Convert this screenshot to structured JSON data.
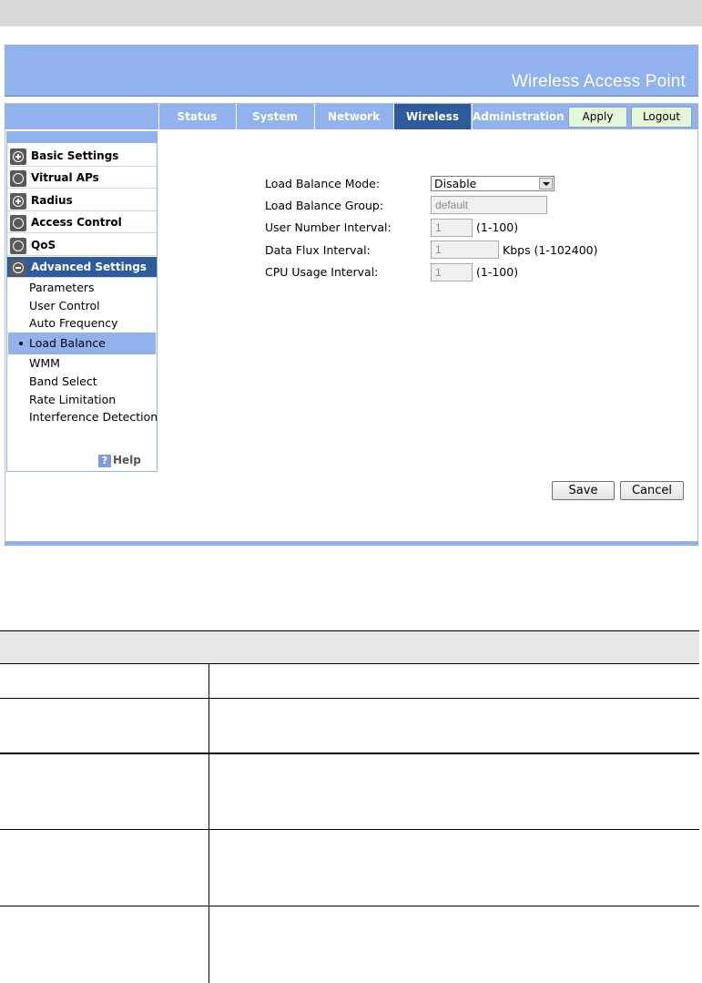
{
  "header": {
    "title": "Wireless Access Point"
  },
  "nav": {
    "tabs": [
      {
        "label": "Status"
      },
      {
        "label": "System"
      },
      {
        "label": "Network"
      },
      {
        "label": "Wireless"
      },
      {
        "label": "Administration"
      }
    ],
    "active_tab": "Wireless",
    "apply_label": "Apply",
    "logout_label": "Logout"
  },
  "sidebar": {
    "sections": [
      {
        "label": "Basic Settings",
        "icon": "plus-icon"
      },
      {
        "label": "Vitrual APs",
        "icon": "circle-icon"
      },
      {
        "label": "Radius",
        "icon": "plus-icon"
      },
      {
        "label": "Access Control",
        "icon": "circle-icon"
      },
      {
        "label": "QoS",
        "icon": "circle-icon"
      },
      {
        "label": "Advanced Settings",
        "icon": "minus-icon"
      }
    ],
    "subitems": [
      "Parameters",
      "User Control",
      "Auto Frequency",
      "Load Balance",
      "WMM",
      "Band Select",
      "Rate Limitation",
      "Interference Detection"
    ],
    "active_subitem": "Load Balance",
    "help_label": "Help"
  },
  "form": {
    "mode_label": "Load Balance Mode:",
    "mode_value": "Disable",
    "group_label": "Load Balance Group:",
    "group_value": "default",
    "user_label": "User Number Interval:",
    "user_value": "1",
    "user_unit": "(1-100)",
    "flux_label": "Data Flux Interval:",
    "flux_value": "1",
    "flux_unit": "Kbps (1-102400)",
    "cpu_label": "CPU Usage Interval:",
    "cpu_value": "1",
    "cpu_unit": "(1-100)"
  },
  "buttons": {
    "save": "Save",
    "cancel": "Cancel"
  },
  "colors": {
    "banner": "#92b2ee",
    "active_tab": "#2e5b9b",
    "button_green": "#e4f7d9"
  }
}
